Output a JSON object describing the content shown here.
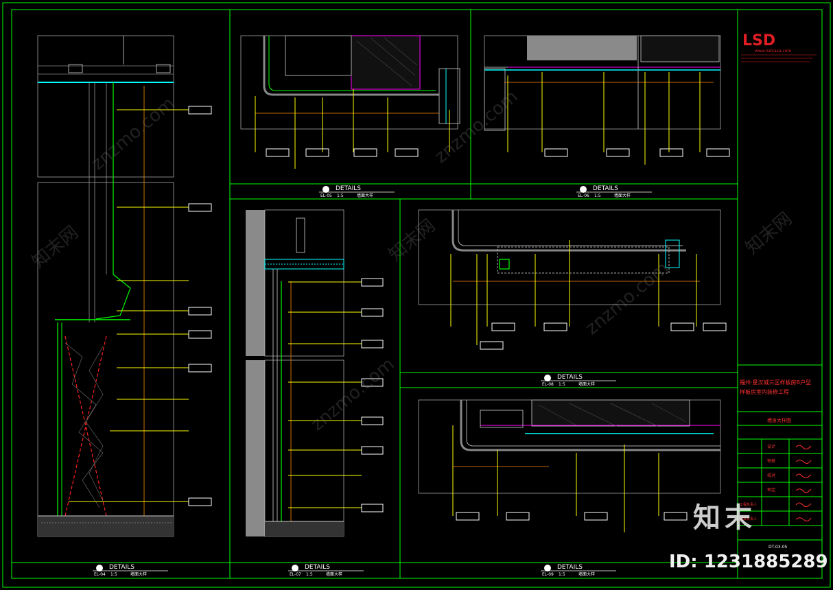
{
  "logo": {
    "brand": "LSD",
    "website": "www.lsdcasa.com",
    "color": "#e01e24"
  },
  "colors": {
    "frame": "#00ff00",
    "background": "#000000",
    "leader": "#ffff00",
    "dimension": "#ff8c00",
    "accent_cyan": "#00ffff",
    "accent_magenta": "#ff00ff",
    "accent_red": "#ff3030",
    "wall_grey": "#808080"
  },
  "details": [
    {
      "title": "DETAILS",
      "sheet": "EL-04",
      "scale": "1:5",
      "name": "墙面大样"
    },
    {
      "title": "DETAILS",
      "sheet": "EL-05",
      "scale": "1:5",
      "name": "墙面大样"
    },
    {
      "title": "DETAILS",
      "sheet": "EL-06",
      "scale": "1:5",
      "name": "墙面大样"
    },
    {
      "title": "DETAILS",
      "sheet": "EL-07",
      "scale": "1:5",
      "name": "墙面大样"
    },
    {
      "title": "DETAILS",
      "sheet": "EL-08",
      "scale": "1:5",
      "name": "墙面大样"
    },
    {
      "title": "DETAILS",
      "sheet": "EL-09",
      "scale": "1:5",
      "name": "墙面大样"
    }
  ],
  "title_block": {
    "project_line1": "福州·星汉城三区样板房B户型",
    "project_line2": "样板房室内装修工程",
    "drawing_name": "墙身大样图",
    "drawing_no": "DT-03-05",
    "sign_rows": [
      "设计",
      "审核",
      "校对",
      "审定",
      "工程负责人",
      "项目负责人"
    ]
  },
  "watermark": {
    "site": "znzmo.com",
    "cn": "知末",
    "net": "知末网",
    "id": "ID: 1231885289"
  }
}
